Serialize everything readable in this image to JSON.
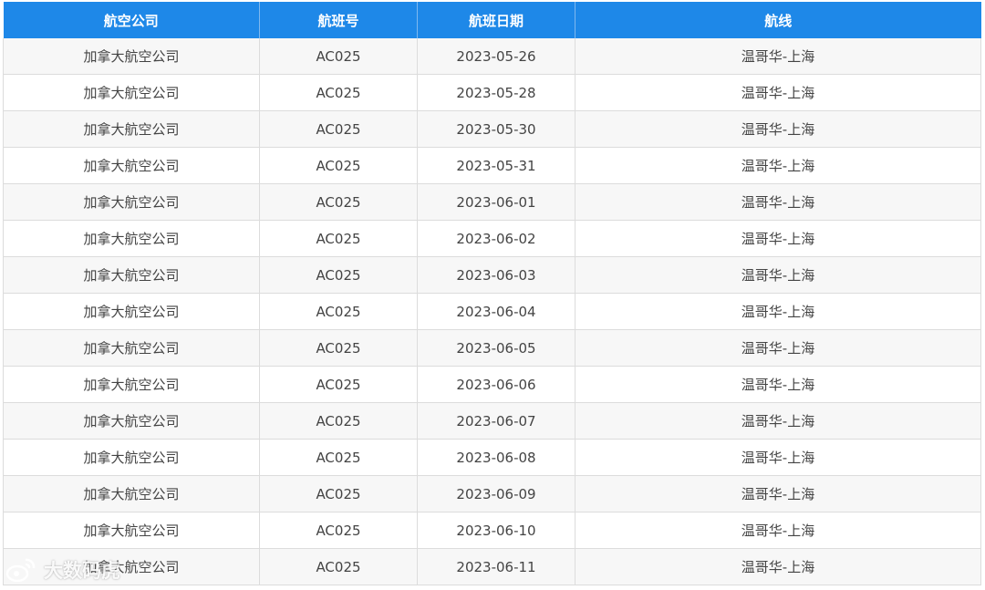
{
  "table": {
    "headers": [
      "航空公司",
      "航班号",
      "航班日期",
      "航线"
    ],
    "rows": [
      [
        "加拿大航空公司",
        "AC025",
        "2023-05-26",
        "温哥华-上海"
      ],
      [
        "加拿大航空公司",
        "AC025",
        "2023-05-28",
        "温哥华-上海"
      ],
      [
        "加拿大航空公司",
        "AC025",
        "2023-05-30",
        "温哥华-上海"
      ],
      [
        "加拿大航空公司",
        "AC025",
        "2023-05-31",
        "温哥华-上海"
      ],
      [
        "加拿大航空公司",
        "AC025",
        "2023-06-01",
        "温哥华-上海"
      ],
      [
        "加拿大航空公司",
        "AC025",
        "2023-06-02",
        "温哥华-上海"
      ],
      [
        "加拿大航空公司",
        "AC025",
        "2023-06-03",
        "温哥华-上海"
      ],
      [
        "加拿大航空公司",
        "AC025",
        "2023-06-04",
        "温哥华-上海"
      ],
      [
        "加拿大航空公司",
        "AC025",
        "2023-06-05",
        "温哥华-上海"
      ],
      [
        "加拿大航空公司",
        "AC025",
        "2023-06-06",
        "温哥华-上海"
      ],
      [
        "加拿大航空公司",
        "AC025",
        "2023-06-07",
        "温哥华-上海"
      ],
      [
        "加拿大航空公司",
        "AC025",
        "2023-06-08",
        "温哥华-上海"
      ],
      [
        "加拿大航空公司",
        "AC025",
        "2023-06-09",
        "温哥华-上海"
      ],
      [
        "加拿大航空公司",
        "AC025",
        "2023-06-10",
        "温哥华-上海"
      ],
      [
        "加拿大航空公司",
        "AC025",
        "2023-06-11",
        "温哥华-上海"
      ]
    ]
  },
  "watermark": {
    "text": "大数码虎",
    "icon": "weibo-logo-icon"
  },
  "colors": {
    "header_bg": "#1e88e8",
    "header_text": "#ffffff",
    "row_alt": "#f7f7f7",
    "grid": "#dcdcdc",
    "cell_text": "#444444"
  }
}
